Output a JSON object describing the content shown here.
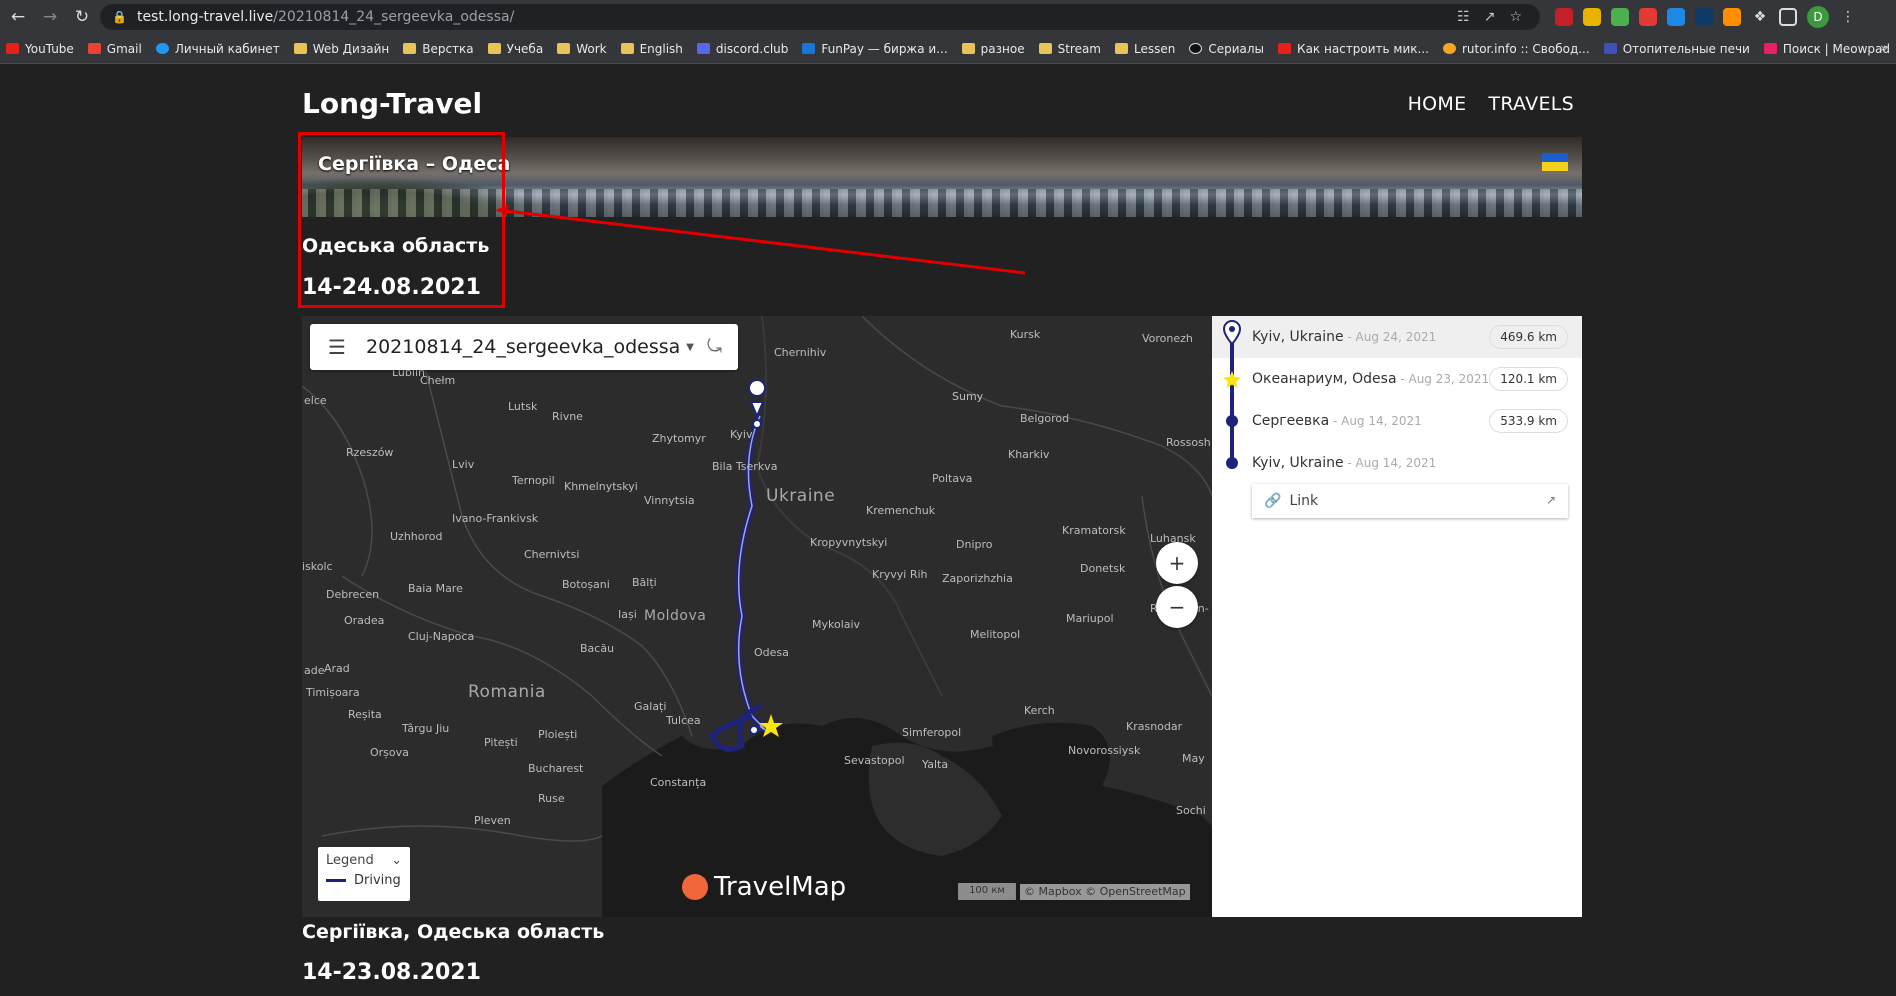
{
  "browser": {
    "url_host": "test.long-travel.live",
    "url_path": "/20210814_24_sergeevka_odessa/",
    "avatar_letter": "D",
    "bookmarks": [
      "YouTube",
      "Gmail",
      "Личный кабинет",
      "Web Дизайн",
      "Верстка",
      "Учеба",
      "Work",
      "English",
      "discord.club",
      "FunPay — биржа и...",
      "разное",
      "Stream",
      "Lessen",
      "Сериалы",
      "Как настроить мик...",
      "rutor.info :: Свобод...",
      "Отопительные печи",
      "Поиск | Meowpad"
    ]
  },
  "site": {
    "title": "Long-Travel",
    "nav": [
      "HOME",
      "TRAVELS"
    ]
  },
  "trip": {
    "banner_title": "Сергіївка – Одеса",
    "region": "Одеська область",
    "dates": "14-24.08.2021"
  },
  "map": {
    "name": "20210814_24_sergeevka_odessa",
    "zoom_in": "+",
    "zoom_out": "−",
    "legend_title": "Legend",
    "legend_item": "Driving",
    "logo": "TravelMap",
    "scale": "100 км",
    "attribution": "© Mapbox © OpenStreetMap",
    "labels": {
      "kursk": "Kursk",
      "voronezh": "Voronezh",
      "chernihiv": "Chernihiv",
      "sumy": "Sumy",
      "lutsk": "Lutsk",
      "rivne": "Rivne",
      "zhytomyr": "Zhytomyr",
      "kyiv": "Kyiv",
      "belgorod": "Belgorod",
      "rzeszow": "Rzeszów",
      "lviv": "Lviv",
      "ternopil": "Ternopil",
      "bila": "Bila Tserkva",
      "kharkiv": "Kharkiv",
      "rossosh": "Rossosh",
      "khmelnytskyi": "Khmelnytskyi",
      "vinnytsia": "Vinnytsia",
      "ukraine": "Ukraine",
      "poltava": "Poltava",
      "ivano": "Ivano-Frankivsk",
      "kremenchuk": "Kremenchuk",
      "uzhhorod": "Uzhhorod",
      "kropyvnytskyi": "Kropyvnytskyi",
      "kramatorsk": "Kramatorsk",
      "luhansk": "Luhansk",
      "chernivtsi": "Chernivtsi",
      "dnipro": "Dnipro",
      "iskolc": "iskolc",
      "donetsk": "Donetsk",
      "botosani": "Botoșani",
      "balti": "Bălți",
      "kryvyi": "Kryvyi Rih",
      "zaporizhzhia": "Zaporizhzhia",
      "baiamare": "Baia Mare",
      "debrecen": "Debrecen",
      "iasi": "Iași",
      "moldova": "Moldova",
      "mykolaiv": "Mykolaiv",
      "mariupol": "Mariupol",
      "rostov": "Rostov-on-",
      "oradea": "Oradea",
      "clujnapoca": "Cluj-Napoca",
      "bacau": "Bacău",
      "odesa": "Odesa",
      "melitopol": "Melitopol",
      "arad": "Arad",
      "timisoara": "Timișoara",
      "romania": "Romania",
      "galati": "Galați",
      "tulcea": "Tulcea",
      "kerch": "Kerch",
      "krasnodar": "Krasnodar",
      "resita": "Reșita",
      "targu": "Târgu Jiu",
      "ploiesti": "Ploiești",
      "pitesti": "Pitești",
      "simferopol": "Simferopol",
      "novorossiysk": "Novorossiysk",
      "orsova": "Orșova",
      "bucharest": "Bucharest",
      "sevastopol": "Sevastopol",
      "yalta": "Yalta",
      "constanta": "Constanța",
      "ruse": "Ruse",
      "pleven": "Pleven",
      "sochi": "Sochi",
      "lublin": "Lublin",
      "chelm": "Chełm",
      "elce": "elce",
      "ade": "ade",
      "may": "May"
    }
  },
  "stops": [
    {
      "name": "Kyiv, Ukraine",
      "date": " - Aug 24, 2021",
      "distance": "469.6 km"
    },
    {
      "name": "Океанариум, Odesa",
      "date": " - Aug 23, 2021",
      "distance": "120.1 km"
    },
    {
      "name": "Сергеевка",
      "date": " - Aug 14, 2021",
      "distance": "533.9 km"
    },
    {
      "name": "Kyiv, Ukraine",
      "date": " - Aug 14, 2021",
      "distance": ""
    }
  ],
  "link_label": "Link",
  "next_trip": {
    "region": "Сергіївка, Одеська область",
    "dates": "14-23.08.2021"
  },
  "colors": {
    "route": "#1d237a",
    "annotation": "#e00000",
    "logo": "#f2663b"
  }
}
